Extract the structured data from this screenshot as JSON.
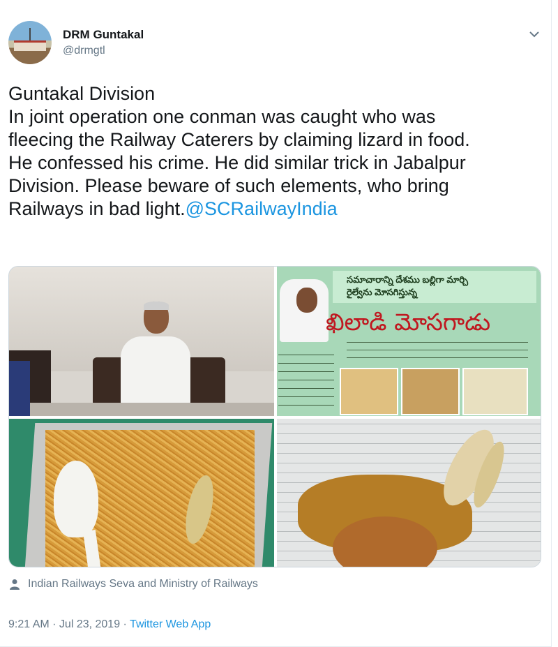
{
  "author": {
    "name": "DRM Guntakal",
    "handle": "@drmgtl"
  },
  "tweet": {
    "lines": [
      "Guntakal Division",
      "In joint operation one conman was caught who was",
      "fleecing the Railway Caterers by claiming lizard in food.",
      "He confessed his crime. He did similar trick in Jabalpur",
      "Division. Please beware of such elements, who bring"
    ],
    "last_line": "Railways in bad light.",
    "mention": "@SCRailwayIndia"
  },
  "media": {
    "poster_text_line1": "సమాచారాన్ని దేశము బల్లిగా మార్చి",
    "poster_text_line2": "రైల్వేను మోసగిస్తున్న",
    "poster_headline": "ఖిలాడి మోసగాడు"
  },
  "tagged": "Indian Railways Seva and Ministry of Railways",
  "meta": {
    "time": "9:21 AM",
    "separator": " · ",
    "date": "Jul 23, 2019",
    "separator2": " · ",
    "app": "Twitter Web App"
  },
  "colors": {
    "link": "#1b95e0",
    "secondary_text": "#657786",
    "text": "#14171a"
  }
}
